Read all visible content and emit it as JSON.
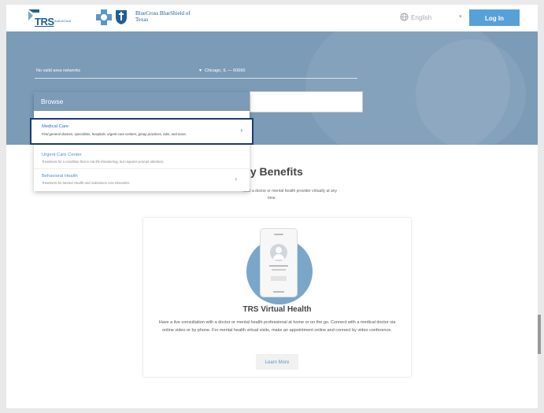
{
  "header": {
    "trs_logo_text": "TRS",
    "trs_logo_sub": "ActiveCare",
    "bcbs_logo_text": "BlueCross BlueShield of Texas",
    "language_label": "English",
    "login_label": "Log In"
  },
  "hero": {
    "network_select": "No valid area networks",
    "location_value": "Chicago, IL — 60660"
  },
  "browse": {
    "header": "Browse",
    "items": [
      {
        "title": "Medical Care",
        "desc": "Find general doctors, specialists, hospitals, urgent care centers, group practices, labs, and more."
      },
      {
        "title": "Urgent Care Center",
        "desc": "Treatment for a condition that is not life threatening, but requires prompt attention."
      },
      {
        "title": "Behavioral Health",
        "desc": "Treatment for Mental Health and Substance Use Disorders."
      }
    ]
  },
  "benefits": {
    "title": "My Benefits",
    "subtitle_line1": "nsult a doctor or mental health provider virtually at any",
    "subtitle_line2": "time."
  },
  "card": {
    "title": "TRS Virtual Health",
    "description": "Have a live consultation with a doctor or mental health professional at home or on the go. Connect with a medical doctor via online video or by phone. For mental health virtual visits, make an appointment online and connect by video conference.",
    "button_label": "Learn More"
  },
  "colors": {
    "hero": "#7b9bb7",
    "accent": "#58a0d8",
    "selection_border": "#1d3b6b"
  }
}
